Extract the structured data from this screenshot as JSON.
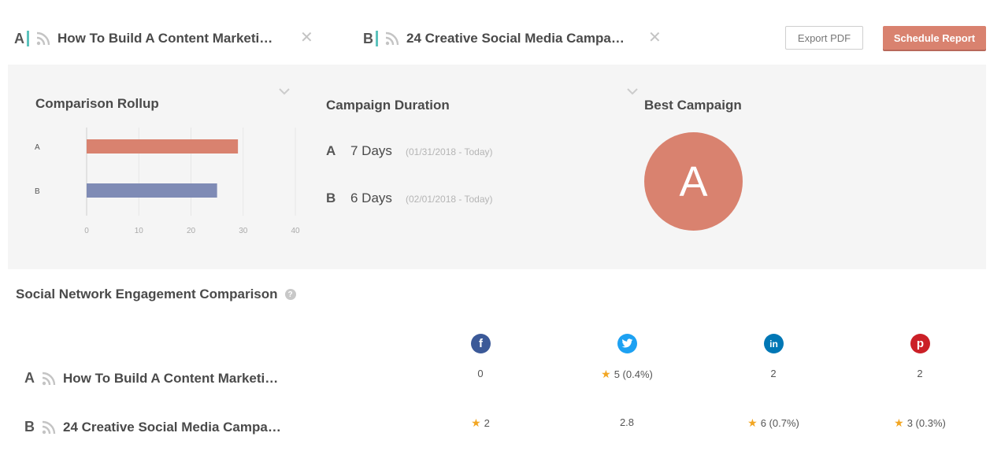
{
  "campaigns": [
    {
      "letter": "A",
      "title": "How To Build A Content Marketi…"
    },
    {
      "letter": "B",
      "title": "24 Creative Social Media Campa…"
    }
  ],
  "close_glyph": "✕",
  "toolbar": {
    "export_label": "Export PDF",
    "schedule_label": "Schedule Report"
  },
  "rollup": {
    "title": "Comparison Rollup",
    "chart_data": {
      "type": "bar",
      "orientation": "horizontal",
      "categories": [
        "A",
        "B"
      ],
      "values": [
        29,
        25
      ],
      "colors": [
        "#d9826f",
        "#7f8bb5"
      ],
      "xlim": [
        0,
        40
      ],
      "xticks": [
        "0",
        "10",
        "20",
        "30",
        "40"
      ],
      "grid": true
    }
  },
  "duration": {
    "title": "Campaign Duration",
    "rows": [
      {
        "letter": "A",
        "days": "7 Days",
        "range": "(01/31/2018 - Today)"
      },
      {
        "letter": "B",
        "days": "6 Days",
        "range": "(02/01/2018 - Today)"
      }
    ]
  },
  "best": {
    "title": "Best Campaign",
    "letter": "A",
    "color": "#d9826f"
  },
  "engagement": {
    "title": "Social Network Engagement Comparison",
    "help_glyph": "?",
    "networks": [
      {
        "icon": "facebook-icon",
        "glyph": "f",
        "color": "#3b5998"
      },
      {
        "icon": "twitter-icon",
        "glyph": "t",
        "color": "#1da1f2"
      },
      {
        "icon": "linkedin-icon",
        "glyph": "in",
        "color": "#0077b5"
      },
      {
        "icon": "pinterest-icon",
        "glyph": "p",
        "color": "#cb2027"
      }
    ],
    "rows": [
      {
        "letter": "A",
        "title": "How To Build A Content Marketi…",
        "cells": [
          {
            "v": "0",
            "star": false
          },
          {
            "v": "5 (0.4%)",
            "star": true
          },
          {
            "v": "2",
            "star": false
          },
          {
            "v": "2",
            "star": false
          }
        ]
      },
      {
        "letter": "B",
        "title": "24 Creative Social Media Campa…",
        "cells": [
          {
            "v": "2",
            "star": true
          },
          {
            "v": "2.8",
            "star": false
          },
          {
            "v": "6 (0.7%)",
            "star": true
          },
          {
            "v": "3 (0.3%)",
            "star": true
          }
        ]
      }
    ]
  },
  "accent_color": "#5cc2bd"
}
